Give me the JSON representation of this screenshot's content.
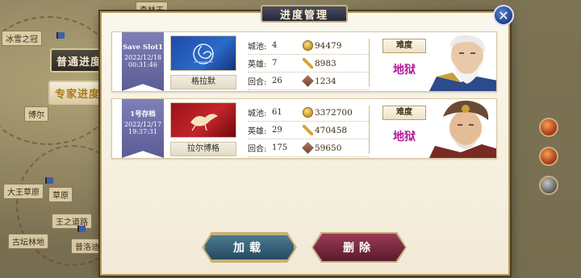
{
  "dialog": {
    "title": "进度管理",
    "close_label": "✕"
  },
  "tabs": [
    {
      "label": "普通进度"
    },
    {
      "label": "专家进度"
    }
  ],
  "map_labels": [
    "森林王",
    "冰雪之冠",
    "大王草原",
    "草原",
    "博尔",
    "王之道路",
    "古坛林地",
    "普洛迪"
  ],
  "slots": [
    {
      "ribbon_name": "Save Slot1",
      "date": "2022/12/18",
      "time": "00:31:46",
      "country": "格拉默",
      "stats": [
        {
          "label": "城池:",
          "value": "4",
          "currency": "94479"
        },
        {
          "label": "英雄:",
          "value": "7",
          "currency": "8983"
        },
        {
          "label": "回合:",
          "value": "26",
          "currency": "1234"
        }
      ],
      "difficulty_label": "难度",
      "difficulty_value": "地狱"
    },
    {
      "ribbon_name": "1号存档",
      "date": "2022/12/17",
      "time": "19:37:31",
      "country": "拉尔博格",
      "stats": [
        {
          "label": "城池:",
          "value": "61",
          "currency": "3372700"
        },
        {
          "label": "英雄:",
          "value": "29",
          "currency": "470458"
        },
        {
          "label": "回合:",
          "value": "175",
          "currency": "59650"
        }
      ],
      "difficulty_label": "难度",
      "difficulty_value": "地狱"
    }
  ],
  "buttons": {
    "load": "加载",
    "delete": "删除"
  },
  "colors": {
    "difficulty": "#b4179a",
    "load_button": "#2f5d74",
    "delete_button": "#7a2740"
  }
}
